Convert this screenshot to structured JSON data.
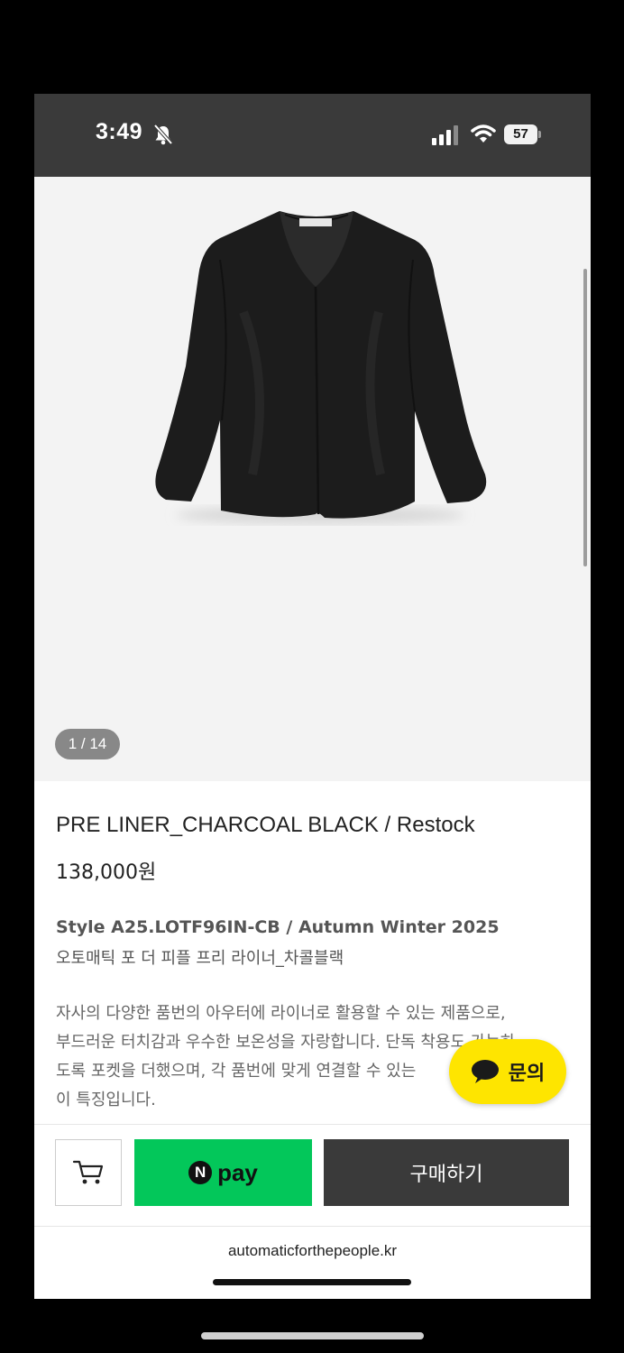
{
  "status_bar": {
    "time": "3:49",
    "battery": "57"
  },
  "gallery": {
    "counter": "1 / 14",
    "image_description": "black collarless jacket"
  },
  "product": {
    "title": "PRE LINER_CHARCOAL BLACK / Restock",
    "price": "138,000원",
    "style_line": "Style A25.LOTF96IN-CB / Autumn Winter 2025",
    "korean_name": "오토매틱 포 더 피플 프리 라이너_차콜블랙",
    "description_lines": [
      "자사의 다양한 품번의 아우터에 라이너로 활용할 수 있는 제품으로,",
      "부드러운 터치감과 우수한 보온성을 자랑합니다. 단독 착용도 가능하",
      "도록 포켓을 더했으며, 각 품번에 맞게 연결할 수 있는",
      "이 특징입니다."
    ]
  },
  "inquiry": {
    "label": "문의",
    "color": "#fee500"
  },
  "actions": {
    "cart_icon": "cart-icon",
    "npay_logo": "N",
    "npay_label": "pay",
    "npay_color": "#03c75a",
    "buy_label": "구매하기"
  },
  "footer": {
    "url": "automaticforthepeople.kr"
  }
}
